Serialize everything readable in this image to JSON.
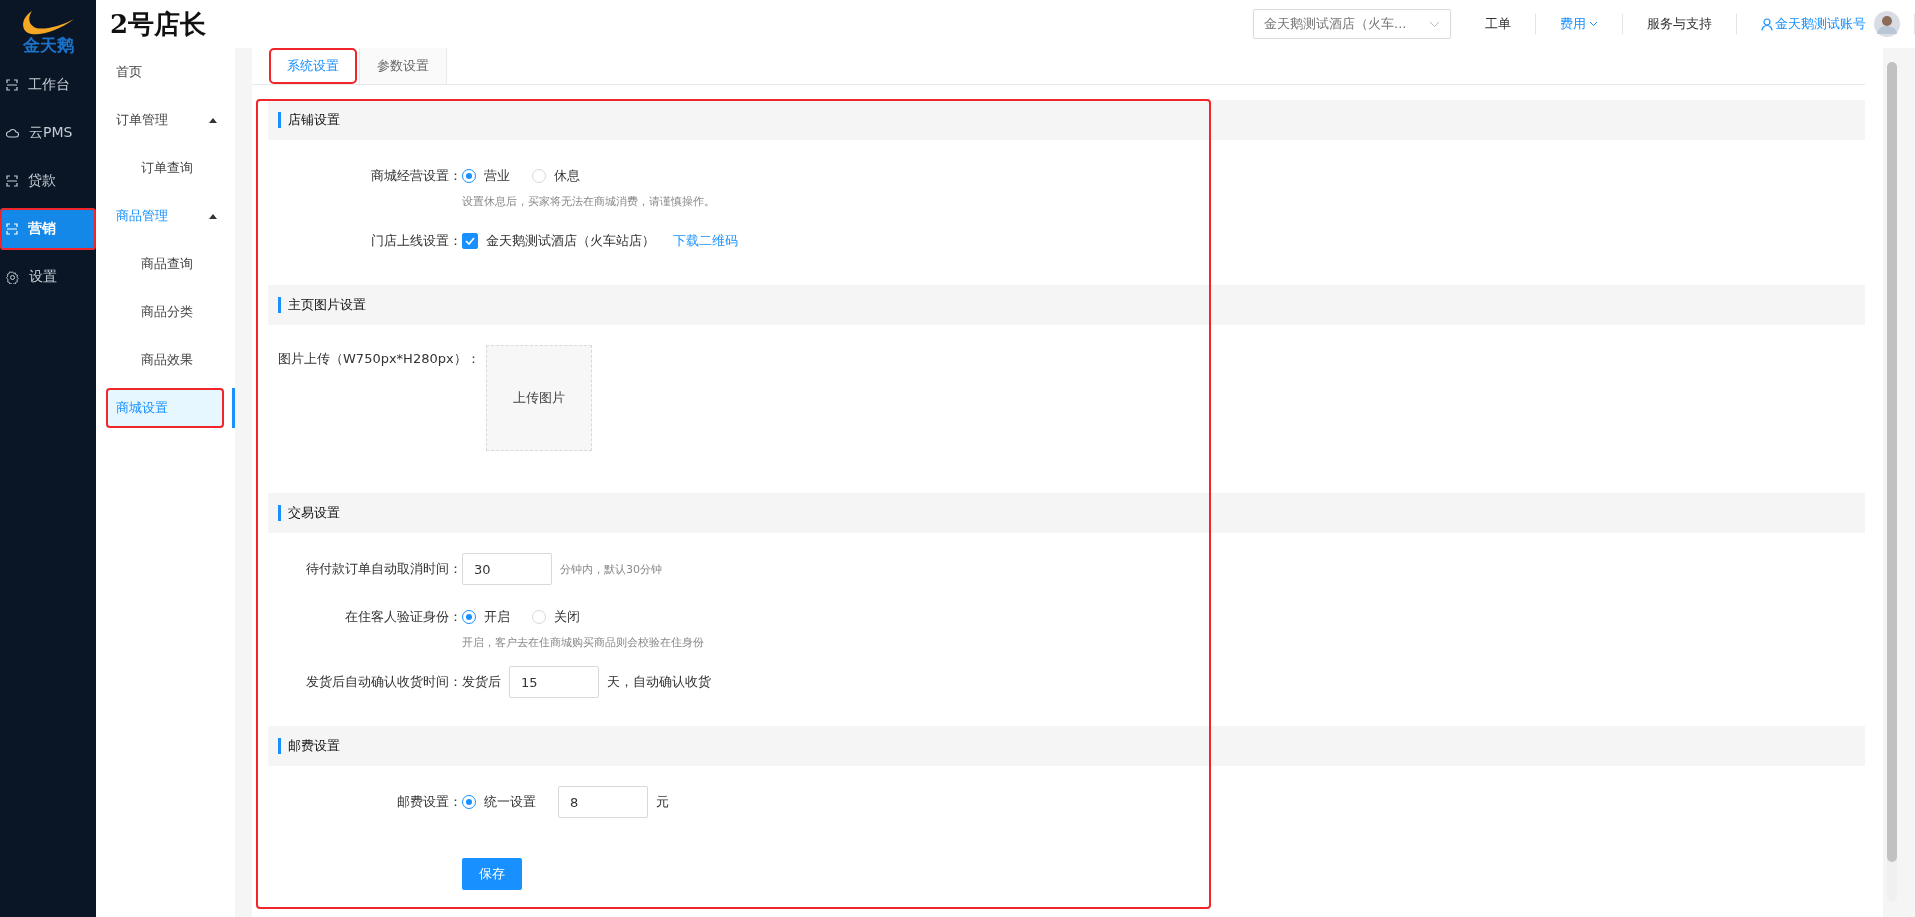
{
  "logo": {
    "text": "金天鹅"
  },
  "header": {
    "title": "2号店长",
    "store_select": {
      "value": "金天鹅测试酒店（火车..."
    },
    "links": [
      {
        "label": "工单",
        "active": false,
        "dropdown": false
      },
      {
        "label": "费用",
        "active": true,
        "dropdown": true
      },
      {
        "label": "服务与支持",
        "active": false,
        "dropdown": false
      }
    ],
    "user": "金天鹅测试账号"
  },
  "sidebar": {
    "items": [
      {
        "label": "工作台",
        "selected": false,
        "highlighted": false
      },
      {
        "label": "云PMS",
        "selected": false,
        "highlighted": false
      },
      {
        "label": "贷款",
        "selected": false,
        "highlighted": false
      },
      {
        "label": "营销",
        "selected": true,
        "highlighted": true
      },
      {
        "label": "设置",
        "selected": false,
        "highlighted": false
      }
    ]
  },
  "submenu": {
    "items": [
      {
        "kind": "link",
        "label": "首页",
        "selected": false,
        "highlighted": false
      },
      {
        "kind": "group",
        "label": "订单管理",
        "expanded": true,
        "active": false,
        "children": [
          {
            "label": "订单查询",
            "selected": false,
            "highlighted": false
          }
        ]
      },
      {
        "kind": "group",
        "label": "商品管理",
        "expanded": true,
        "active": true,
        "children": [
          {
            "label": "商品查询",
            "selected": false,
            "highlighted": false
          },
          {
            "label": "商品分类",
            "selected": false,
            "highlighted": false
          },
          {
            "label": "商品效果",
            "selected": false,
            "highlighted": false
          },
          {
            "label": "商城设置",
            "selected": true,
            "highlighted": true
          }
        ]
      }
    ]
  },
  "tabs": [
    {
      "label": "系统设置",
      "selected": true,
      "highlighted": true
    },
    {
      "label": "参数设置",
      "selected": false,
      "highlighted": false
    }
  ],
  "form": {
    "highlighted": true,
    "sections": [
      {
        "title": "店铺设置",
        "rows": [
          {
            "kind": "radio",
            "label": "商城经营设置：",
            "options": [
              {
                "label": "营业",
                "selected": true
              },
              {
                "label": "休息",
                "selected": false
              }
            ],
            "hint": "设置休息后，买家将无法在商城消费，请谨慎操作。"
          },
          {
            "kind": "checkbox",
            "label": "门店上线设置：",
            "checked": true,
            "text": "金天鹅测试酒店（火车站店）",
            "link": "下载二维码"
          }
        ]
      },
      {
        "title": "主页图片设置",
        "rows": [
          {
            "kind": "upload",
            "label": "图片上传（W750px*H280px）：",
            "button": "上传图片"
          }
        ]
      },
      {
        "title": "交易设置",
        "rows": [
          {
            "kind": "input",
            "label": "待付款订单自动取消时间：",
            "value": "30",
            "suffix": "分钟内，默认30分钟",
            "suffix_muted": true
          },
          {
            "kind": "radio",
            "label": "在住客人验证身份：",
            "options": [
              {
                "label": "开启",
                "selected": true
              },
              {
                "label": "关闭",
                "selected": false
              }
            ],
            "hint": "开启，客户去在住商城购买商品则会校验在住身份"
          },
          {
            "kind": "input",
            "label": "发货后自动确认收货时间：",
            "prefix": "发货后",
            "value": "15",
            "suffix": "天，自动确认收货",
            "suffix_muted": false
          }
        ]
      },
      {
        "title": "邮费设置",
        "rows": [
          {
            "kind": "radio_input",
            "label": "邮费设置：",
            "options": [
              {
                "label": "统一设置",
                "selected": true
              }
            ],
            "value": "8",
            "suffix": "元"
          }
        ]
      }
    ],
    "save": "保存"
  }
}
